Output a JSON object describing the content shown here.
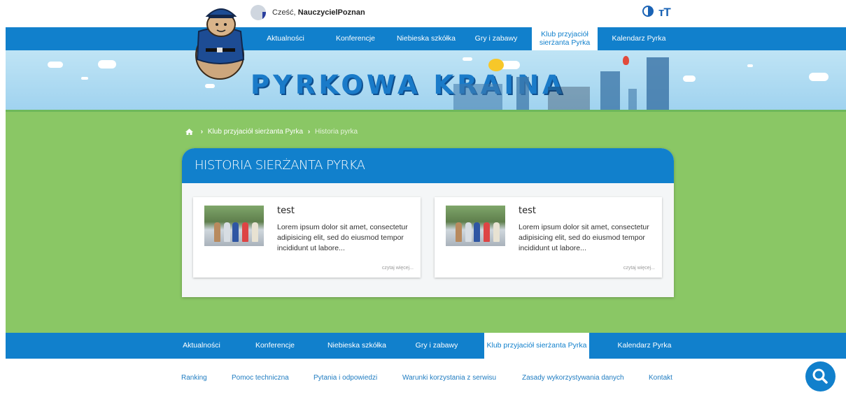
{
  "header": {
    "greeting_prefix": "Cześć,",
    "username": "NauczycielPoznan"
  },
  "nav": {
    "items": [
      {
        "label": "Aktualności"
      },
      {
        "label": "Konferencje"
      },
      {
        "label": "Niebieska szkółka"
      },
      {
        "label": "Gry i zabawy"
      },
      {
        "label_line1": "Klub przyjaciół",
        "label_line2": "sierżanta Pyrka",
        "active": true
      },
      {
        "label": "Kalendarz Pyrka"
      }
    ]
  },
  "banner": {
    "title": "PYRKOWA KRAINA"
  },
  "breadcrumb": {
    "items": [
      "Klub przyjaciół sierżanta Pyrka",
      "Historia pyrka"
    ]
  },
  "section": {
    "title": "HISTORIA SIERŻANTA PYRKA",
    "articles": [
      {
        "title": "test",
        "excerpt": "Lorem ipsum dolor sit amet, consectetur adipisicing elit, sed do eiusmod tempor incididunt ut labore...",
        "more": "czytaj więcej..."
      },
      {
        "title": "test",
        "excerpt": "Lorem ipsum dolor sit amet, consectetur adipisicing elit, sed do eiusmod tempor incididunt ut labore...",
        "more": "czytaj więcej..."
      }
    ]
  },
  "bottom_nav": {
    "items": [
      {
        "label": "Aktualności"
      },
      {
        "label": "Konferencje"
      },
      {
        "label": "Niebieska szkółka"
      },
      {
        "label": "Gry i zabawy"
      },
      {
        "label": "Klub przyjaciół sierżanta Pyrka",
        "active": true
      },
      {
        "label": "Kalendarz Pyrka"
      }
    ]
  },
  "footer": {
    "links": [
      "Ranking",
      "Pomoc techniczna",
      "Pytania i odpowiedzi",
      "Warunki korzystania z serwisu",
      "Zasady wykorzystywania danych",
      "Kontakt"
    ]
  },
  "icons": {
    "contrast": "contrast-icon",
    "text_size": "text-size-icon",
    "home": "home-icon",
    "search": "search-icon"
  },
  "colors": {
    "primary_blue": "#1180cc",
    "green": "#8ac765"
  }
}
